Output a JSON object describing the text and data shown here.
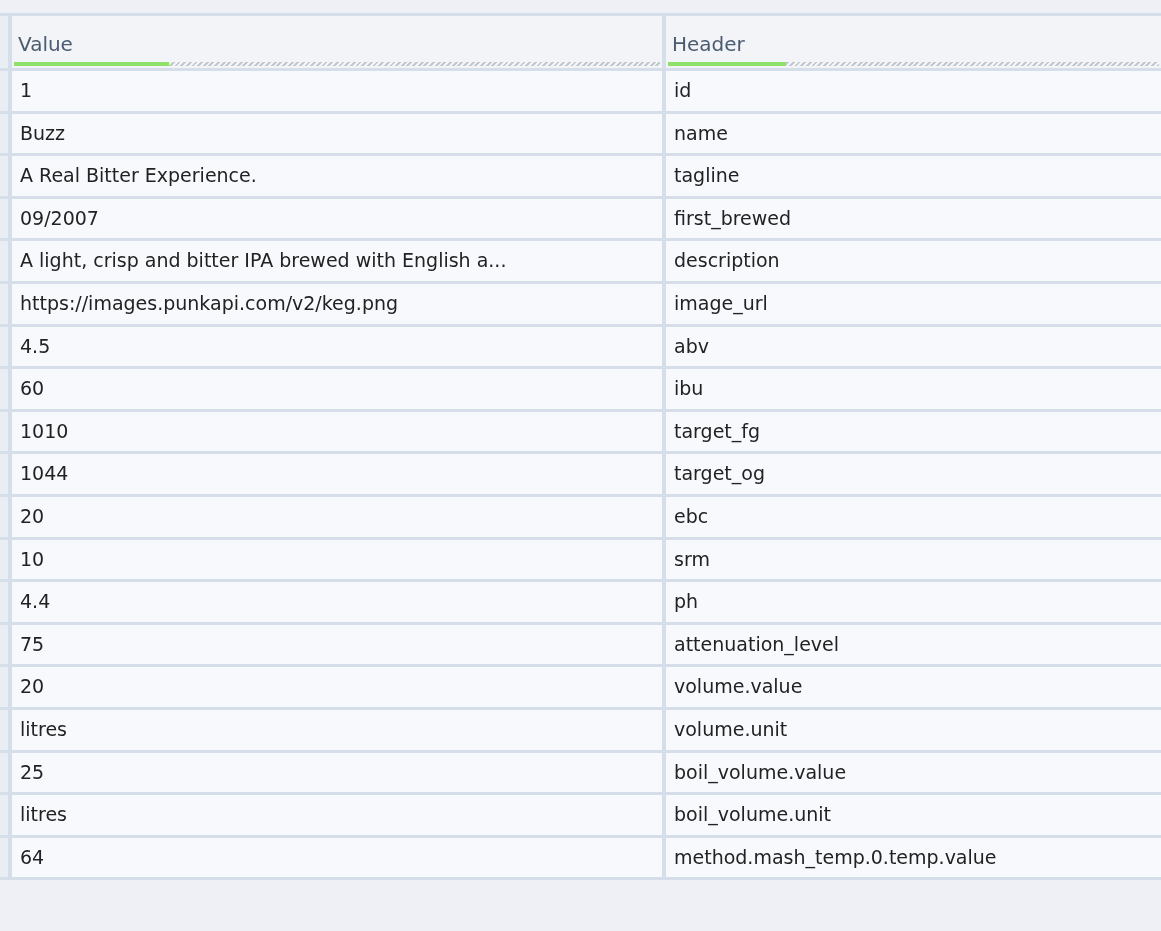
{
  "table": {
    "columns": [
      {
        "label": "Value",
        "level": 0.24
      },
      {
        "label": "Header",
        "level": 0.24
      }
    ],
    "rows": [
      [
        "1",
        "id"
      ],
      [
        "Buzz",
        "name"
      ],
      [
        "A Real Bitter Experience.",
        "tagline"
      ],
      [
        "09/2007",
        "first_brewed"
      ],
      [
        "A light, crisp and bitter IPA brewed with English a...",
        "description"
      ],
      [
        "https://images.punkapi.com/v2/keg.png",
        "image_url"
      ],
      [
        "4.5",
        "abv"
      ],
      [
        "60",
        "ibu"
      ],
      [
        "1010",
        "target_fg"
      ],
      [
        "1044",
        "target_og"
      ],
      [
        "20",
        "ebc"
      ],
      [
        "10",
        "srm"
      ],
      [
        "4.4",
        "ph"
      ],
      [
        "75",
        "attenuation_level"
      ],
      [
        "20",
        "volume.value"
      ],
      [
        "litres",
        "volume.unit"
      ],
      [
        "25",
        "boil_volume.value"
      ],
      [
        "litres",
        "boil_volume.unit"
      ],
      [
        "64",
        "method.mash_temp.0.temp.value"
      ]
    ]
  }
}
